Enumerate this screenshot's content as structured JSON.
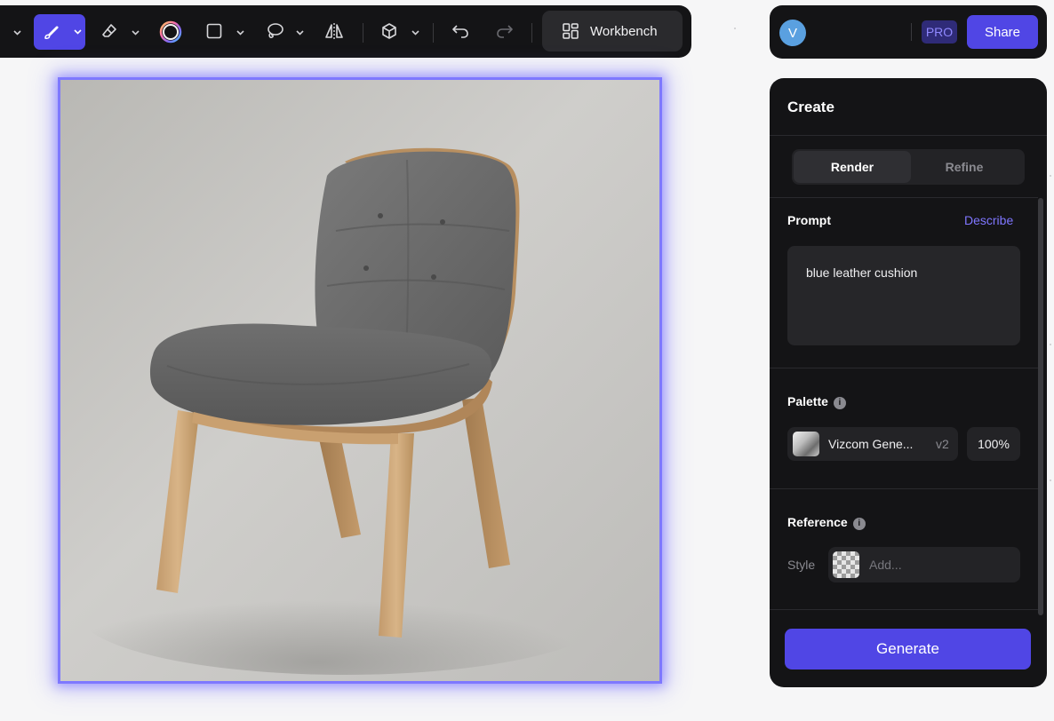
{
  "toolbar": {
    "items": [
      {
        "icon": "chevron-down-icon"
      },
      {
        "icon": "brush-icon",
        "active": true
      },
      {
        "icon": "eraser-icon"
      },
      {
        "icon": "color-ring-icon"
      },
      {
        "icon": "rectangle-icon"
      },
      {
        "icon": "lasso-icon"
      },
      {
        "icon": "mirror-icon"
      },
      {
        "icon": "cube-icon"
      },
      {
        "icon": "undo-icon"
      },
      {
        "icon": "redo-icon"
      }
    ],
    "workbench_label": "Workbench",
    "workbench_icon": "grid-icon"
  },
  "user": {
    "avatar_initial": "V",
    "avatar_color": "#5aa0e0",
    "pro_badge": "PRO",
    "share_label": "Share"
  },
  "canvas": {
    "image_description_icon": "render-image",
    "highlight_color": "#7e78ff"
  },
  "panel": {
    "title": "Create",
    "tabs": [
      {
        "label": "Render",
        "active": true
      },
      {
        "label": "Refine",
        "active": false
      }
    ],
    "prompt": {
      "label": "Prompt",
      "describe_link": "Describe",
      "text": "blue leather cushion"
    },
    "palette": {
      "label": "Palette",
      "name": "Vizcom Gene...",
      "version": "v2",
      "strength": "100%"
    },
    "reference": {
      "label": "Reference",
      "style_label": "Style",
      "placeholder": "Add..."
    },
    "generate_label": "Generate"
  },
  "colors": {
    "accent": "#5046e5",
    "panel_bg": "#141416",
    "link": "#7f76ff"
  }
}
